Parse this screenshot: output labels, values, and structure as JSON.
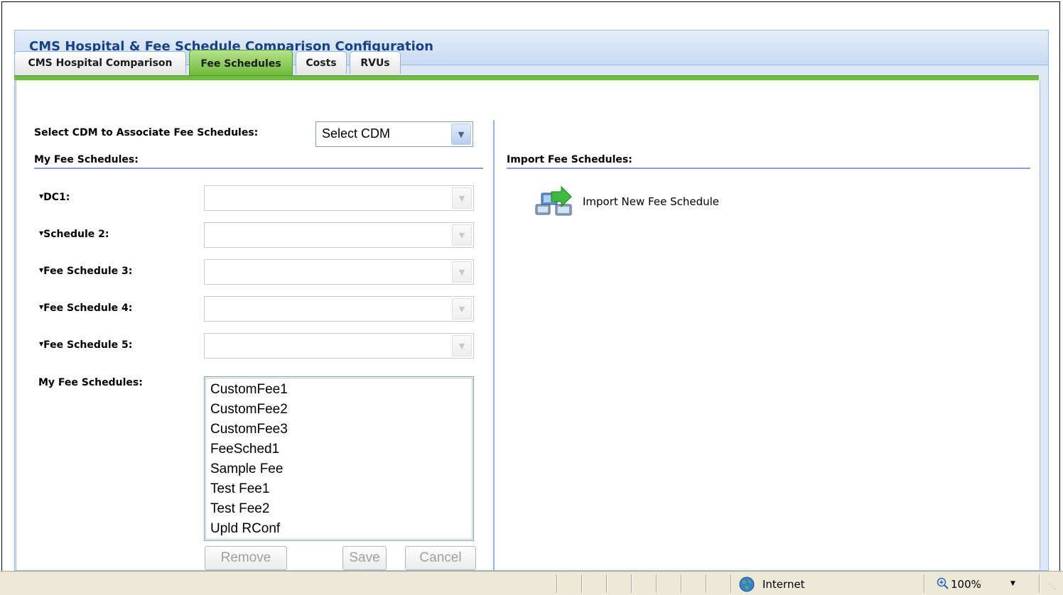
{
  "panel": {
    "title": "CMS Hospital & Fee Schedule Comparison Configuration"
  },
  "tabs": [
    {
      "label": "CMS Hospital Comparison",
      "active": false
    },
    {
      "label": "Fee Schedules",
      "active": true
    },
    {
      "label": "Costs",
      "active": false
    },
    {
      "label": "RVUs",
      "active": false
    }
  ],
  "cdm": {
    "label": "Select CDM to Associate Fee Schedules:",
    "value": "Select CDM"
  },
  "left": {
    "section_title": "My Fee Schedules:",
    "schedules": [
      {
        "label": "DC1:",
        "value": ""
      },
      {
        "label": "Schedule 2:",
        "value": ""
      },
      {
        "label": "Fee Schedule 3:",
        "value": ""
      },
      {
        "label": "Fee Schedule 4:",
        "value": ""
      },
      {
        "label": "Fee Schedule 5:",
        "value": ""
      }
    ],
    "list_label": "My Fee Schedules:",
    "list_items": [
      "CustomFee1",
      "CustomFee2",
      "CustomFee3",
      "FeeSched1",
      "Sample Fee",
      "Test Fee1",
      "Test Fee2",
      "Upld RConf"
    ],
    "buttons": {
      "remove": "Remove",
      "save": "Save",
      "cancel": "Cancel"
    }
  },
  "right": {
    "section_title": "Import Fee Schedules:",
    "import_link": "Import New Fee Schedule"
  },
  "statusbar": {
    "zone": "Internet",
    "zoom": "100%"
  },
  "icons": {
    "import": "import-icon",
    "globe": "internet-zone-icon",
    "zoom": "zoom-icon",
    "dropdown": "chevron-down-icon",
    "marker": "triangle-down-icon"
  },
  "colors": {
    "title_text": "#15428b",
    "active_tab": "#6cbf3c",
    "panel_border": "#99bbe8",
    "section_rule": "#8c9dde"
  }
}
